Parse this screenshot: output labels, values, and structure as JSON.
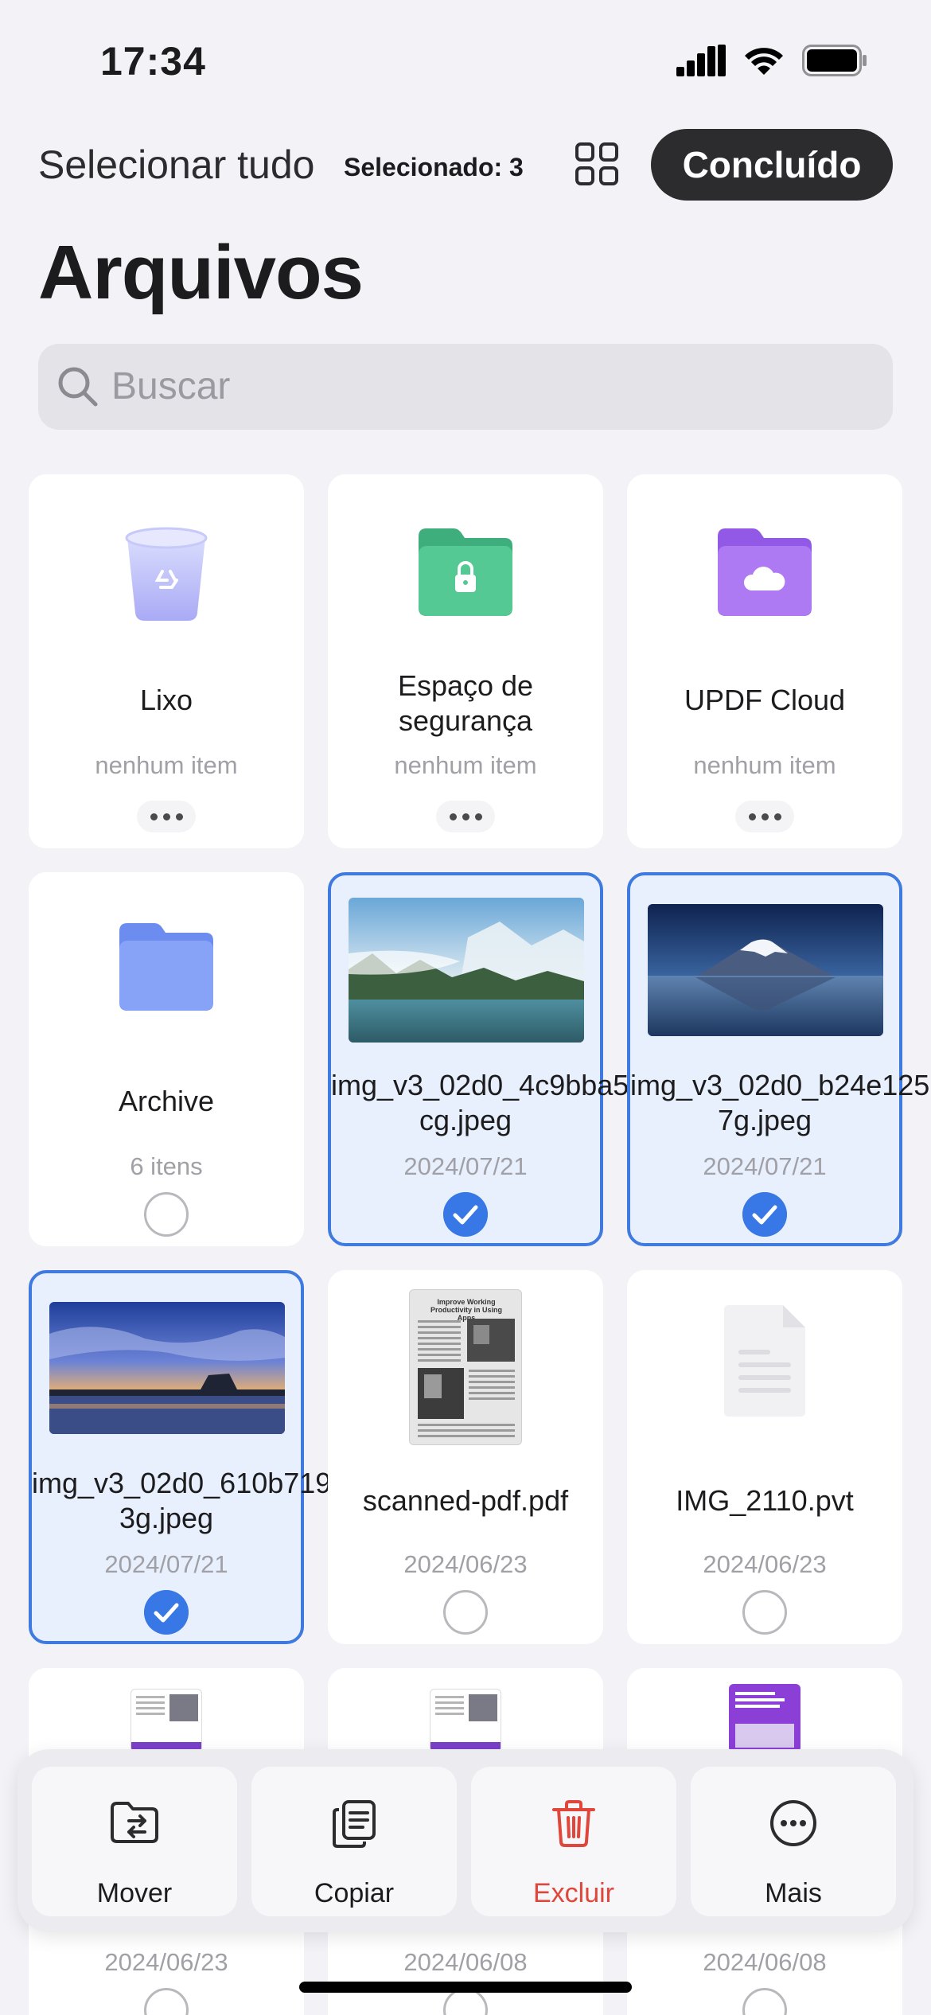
{
  "status_bar": {
    "time": "17:34"
  },
  "topbar": {
    "select_all": "Selecionar tudo",
    "selected_count": "Selecionado: 3",
    "done_label": "Concluído"
  },
  "page": {
    "title": "Arquivos"
  },
  "search": {
    "placeholder": "Buscar"
  },
  "colors": {
    "accent": "#3878e6",
    "danger": "#e0463a",
    "trash": "#b7b9f8",
    "secure_folder": "#49bd8b",
    "cloud_folder": "#a36cf0",
    "archive_folder": "#7f9cf6"
  },
  "files": [
    {
      "name": "Lixo",
      "sub": "nenhum item",
      "icon": "trash-bin-icon",
      "selected": false
    },
    {
      "name": "Espaço de segurança",
      "sub": "nenhum item",
      "icon": "lock-folder-icon",
      "selected": false
    },
    {
      "name": "UPDF Cloud",
      "sub": "nenhum item",
      "icon": "cloud-folder-icon",
      "selected": false
    },
    {
      "name": "Archive",
      "sub": "6 itens",
      "icon": "folder-icon",
      "selected": false
    },
    {
      "name": "img_v3_02d0_4c9bba5…cg.jpeg",
      "sub": "2024/07/21",
      "icon": "image-thumbnail",
      "selected": true
    },
    {
      "name": "img_v3_02d0_b24e125…7g.jpeg",
      "sub": "2024/07/21",
      "icon": "image-thumbnail",
      "selected": true
    },
    {
      "name": "img_v3_02d0_610b719…3g.jpeg",
      "sub": "2024/07/21",
      "icon": "image-thumbnail",
      "selected": true
    },
    {
      "name": "scanned-pdf.pdf",
      "sub": "2024/06/23",
      "icon": "pdf-thumbnail",
      "selected": false
    },
    {
      "name": "IMG_2110.pvt",
      "sub": "2024/06/23",
      "icon": "document-icon",
      "selected": false
    },
    {
      "name": "",
      "sub": "2024/06/23",
      "icon": "pdf-thumbnail",
      "selected": false
    },
    {
      "name": "",
      "sub": "2024/06/08",
      "icon": "pdf-thumbnail",
      "selected": false
    },
    {
      "name": "",
      "sub": "2024/06/08",
      "icon": "pdf-thumbnail",
      "selected": false
    }
  ],
  "actions": [
    {
      "label": "Mover",
      "icon": "move-folder-icon"
    },
    {
      "label": "Copiar",
      "icon": "copy-icon"
    },
    {
      "label": "Excluir",
      "icon": "trash-icon"
    },
    {
      "label": "Mais",
      "icon": "more-icon"
    }
  ],
  "thumb_texts": {
    "scanned_title": "Improve Working Productivity in Using Apps"
  }
}
